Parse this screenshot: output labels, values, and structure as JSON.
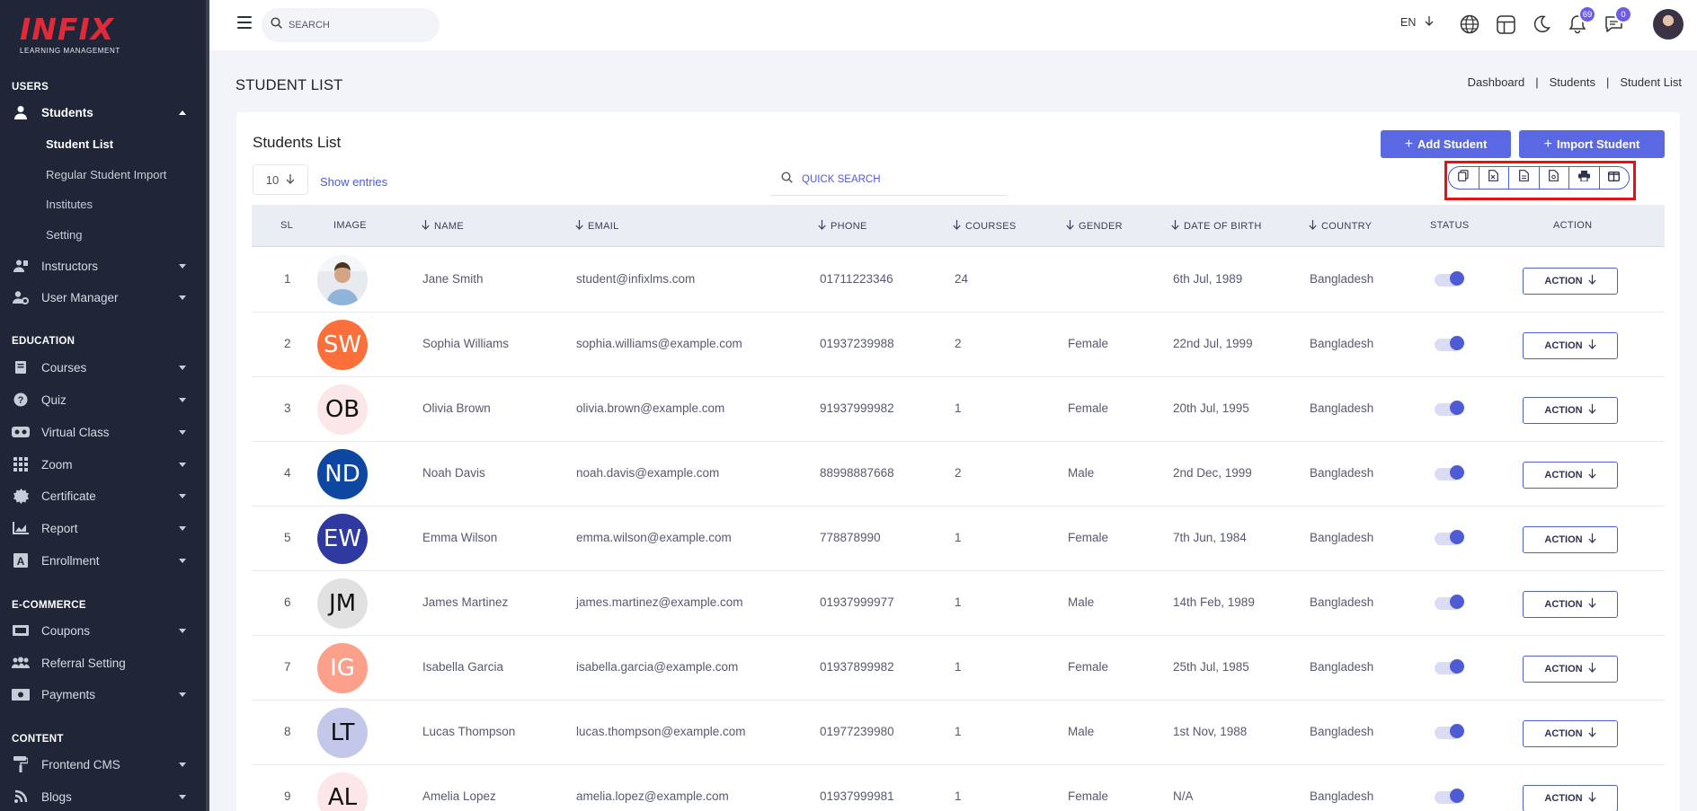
{
  "sidebar": {
    "logo": {
      "word": "INFIX",
      "sub": "LEARNING MANAGEMENT"
    },
    "sections": {
      "users": "USERS",
      "education": "EDUCATION",
      "ecommerce": "E-COMMERCE",
      "content": "CONTENT"
    },
    "items": {
      "students": "Students",
      "instructors": "Instructors",
      "user_manager": "User Manager",
      "courses": "Courses",
      "quiz": "Quiz",
      "virtual_class": "Virtual Class",
      "zoom": "Zoom",
      "certificate": "Certificate",
      "report": "Report",
      "enrollment": "Enrollment",
      "coupons": "Coupons",
      "referral_setting": "Referral Setting",
      "payments": "Payments",
      "frontend_cms": "Frontend CMS",
      "blogs": "Blogs"
    },
    "sub_items": {
      "student_list": "Student List",
      "regular_student_import": "Regular Student Import",
      "institutes": "Institutes",
      "setting": "Setting"
    }
  },
  "topbar": {
    "search_placeholder": "SEARCH",
    "language": "EN",
    "notifications_count": "69",
    "messages_count": "0"
  },
  "page": {
    "title": "STUDENT LIST",
    "breadcrumb": [
      "Dashboard",
      "Students",
      "Student List"
    ]
  },
  "card": {
    "title": "Students List",
    "add_student": "Add Student",
    "import_student": "Import Student",
    "entries_value": "10",
    "entries_label": "Show entries",
    "quick_search_placeholder": "QUICK SEARCH"
  },
  "table": {
    "headers": {
      "sl": "SL",
      "image": "IMAGE",
      "name": "NAME",
      "email": "EMAIL",
      "phone": "PHONE",
      "courses": "COURSES",
      "gender": "GENDER",
      "dob": "DATE OF BIRTH",
      "country": "COUNTRY",
      "status": "STATUS",
      "action": "ACTION"
    },
    "action_label": "ACTION",
    "rows": [
      {
        "sl": "1",
        "initials": "",
        "avatar_color": "#dfe3ea",
        "name": "Jane Smith",
        "email": "student@infixlms.com",
        "phone": "01711223346",
        "courses": "24",
        "gender": "",
        "dob": "6th Jul, 1989",
        "country": "Bangladesh",
        "status": true
      },
      {
        "sl": "2",
        "initials": "SW",
        "avatar_color": "#fb6f3a",
        "name": "Sophia Williams",
        "email": "sophia.williams@example.com",
        "phone": "01937239988",
        "courses": "2",
        "gender": "Female",
        "dob": "22nd Jul, 1999",
        "country": "Bangladesh",
        "status": true
      },
      {
        "sl": "3",
        "initials": "OB",
        "avatar_color": "#fbe7e7",
        "name": "Olivia Brown",
        "email": "olivia.brown@example.com",
        "phone": "91937999982",
        "courses": "1",
        "gender": "Female",
        "dob": "20th Jul, 1995",
        "country": "Bangladesh",
        "status": true
      },
      {
        "sl": "4",
        "initials": "ND",
        "avatar_color": "#0d47a1",
        "name": "Noah Davis",
        "email": "noah.davis@example.com",
        "phone": "88998887668",
        "courses": "2",
        "gender": "Male",
        "dob": "2nd Dec, 1999",
        "country": "Bangladesh",
        "status": true
      },
      {
        "sl": "5",
        "initials": "EW",
        "avatar_color": "#2e3aa0",
        "name": "Emma Wilson",
        "email": "emma.wilson@example.com",
        "phone": "778878990",
        "courses": "1",
        "gender": "Female",
        "dob": "7th Jun, 1984",
        "country": "Bangladesh",
        "status": true
      },
      {
        "sl": "6",
        "initials": "JM",
        "avatar_color": "#e1e1e1",
        "name": "James Martinez",
        "email": "james.martinez@example.com",
        "phone": "01937999977",
        "courses": "1",
        "gender": "Male",
        "dob": "14th Feb, 1989",
        "country": "Bangladesh",
        "status": true
      },
      {
        "sl": "7",
        "initials": "IG",
        "avatar_color": "#fba18b",
        "name": "Isabella Garcia",
        "email": "isabella.garcia@example.com",
        "phone": "01937899982",
        "courses": "1",
        "gender": "Female",
        "dob": "25th Jul, 1985",
        "country": "Bangladesh",
        "status": true
      },
      {
        "sl": "8",
        "initials": "LT",
        "avatar_color": "#c3c8ea",
        "name": "Lucas Thompson",
        "email": "lucas.thompson@example.com",
        "phone": "01977239980",
        "courses": "1",
        "gender": "Male",
        "dob": "1st Nov, 1988",
        "country": "Bangladesh",
        "status": true
      },
      {
        "sl": "9",
        "initials": "AL",
        "avatar_color": "#fce6e8",
        "name": "Amelia Lopez",
        "email": "amelia.lopez@example.com",
        "phone": "01937999981",
        "courses": "1",
        "gender": "Female",
        "dob": "N/A",
        "country": "Bangladesh",
        "status": true
      }
    ]
  },
  "colors": {
    "accent": "#5b68e3",
    "sidebar_bg": "#202638",
    "highlight": "#ea1010"
  }
}
